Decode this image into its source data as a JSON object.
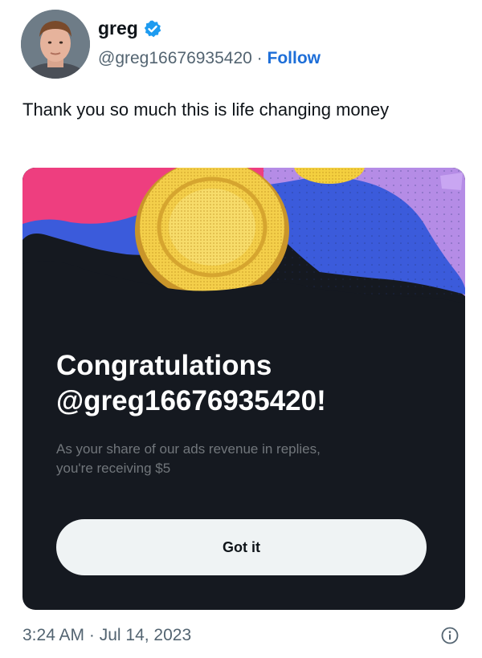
{
  "author": {
    "display_name": "greg",
    "verified_icon": "verified-badge-icon",
    "handle": "@greg16676935420",
    "separator": "·",
    "follow_label": "Follow",
    "accent_color": "#1d9bf0"
  },
  "tweet": {
    "text": "Thank you so much this is life changing money",
    "timestamp": "3:24 AM · Jul 14, 2023",
    "info_icon": "info-circle-icon"
  },
  "card": {
    "title_line1": "Congratulations",
    "title_line2": "@greg16676935420!",
    "body_line1": "As your share of our ads revenue in replies,",
    "body_line2": "you're receiving $5",
    "button_label": "Got it",
    "background_color": "#151920",
    "illustration": "gold-coin-illustration"
  }
}
